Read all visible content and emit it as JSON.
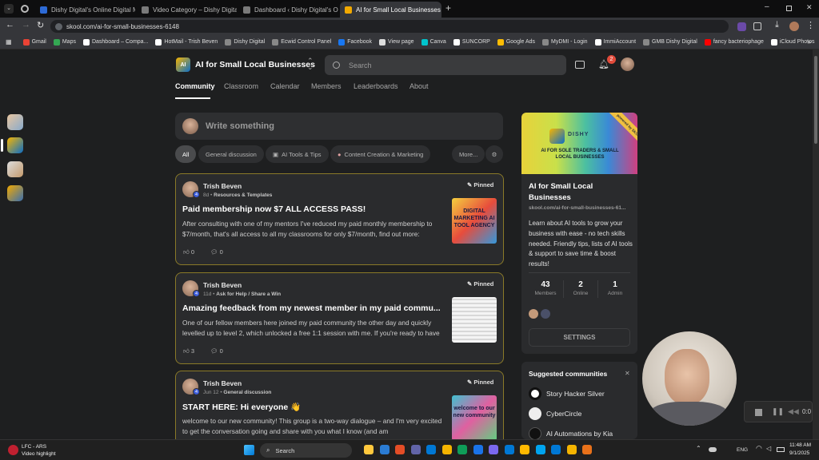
{
  "browser": {
    "tabs": [
      {
        "label": "Dishy Digital's Online Digital M",
        "color": "#2d6ad6"
      },
      {
        "label": "Video Category – Dishy Digital",
        "color": "#7a7a7a"
      },
      {
        "label": "Dashboard ‹ Dishy Digital's On",
        "color": "#7a7a7a"
      },
      {
        "label": "AI for Small Local Businesses",
        "color": "#f2a900"
      }
    ],
    "url": "skool.com/ai-for-small-businesses-6148",
    "bookmarks": [
      {
        "label": "Gmail",
        "color": "#ea4335"
      },
      {
        "label": "Maps",
        "color": "#34a853"
      },
      {
        "label": "Dashboard – Compa...",
        "color": "#ffffff"
      },
      {
        "label": "HotMail - Trish Beven",
        "color": "#ffffff"
      },
      {
        "label": "Dishy Digital",
        "color": "#888888"
      },
      {
        "label": "Ecwid Control Panel",
        "color": "#888888"
      },
      {
        "label": "Facebook",
        "color": "#1877f2"
      },
      {
        "label": "View page",
        "color": "#dddddd"
      },
      {
        "label": "Canva",
        "color": "#00c4cc"
      },
      {
        "label": "SUNCORP",
        "color": "#ffffff"
      },
      {
        "label": "Google Ads",
        "color": "#fbbc04"
      },
      {
        "label": "MyDMI - Login",
        "color": "#888888"
      },
      {
        "label": "ImmiAccount",
        "color": "#ffffff"
      },
      {
        "label": "GMB Dishy Digital",
        "color": "#888888"
      },
      {
        "label": "fancy bacteriophage",
        "color": "#ff0000"
      },
      {
        "label": "iCloud Photos",
        "color": "#ffffff"
      }
    ]
  },
  "header": {
    "logo_text": "AI",
    "group_name": "AI for Small Local Businesses",
    "search_placeholder": "Search",
    "notif_count": "2"
  },
  "nav": [
    "Community",
    "Classroom",
    "Calendar",
    "Members",
    "Leaderboards",
    "About"
  ],
  "composer": {
    "placeholder": "Write something"
  },
  "filters": [
    "All",
    "General discussion",
    "AI Tools & Tips",
    "Content Creation & Marketing",
    "More..."
  ],
  "posts": [
    {
      "author": "Trish Beven",
      "level": "4",
      "time": "8d",
      "category": "Resources & Templates",
      "pinned": "Pinned",
      "title": "Paid membership now $7 ALL ACCESS PASS!",
      "body": "After consulting with one of my mentors I've reduced my paid monthly membership to $7/month, that's all access to all my classrooms for only $7/month, find out more:",
      "likes": "0",
      "comments": "0",
      "thumb_text": "DIGITAL MARKETING AI TOOL AGENCY"
    },
    {
      "author": "Trish Beven",
      "level": "4",
      "time": "11d",
      "category": "Ask for Help / Share a Win",
      "pinned": "Pinned",
      "title": "Amazing feedback from my newest member in my paid commu...",
      "body": "One of our fellow members here joined my paid community the other day and quickly levelled up to level 2, which unlocked a free 1:1 session with me. If you're ready to have",
      "likes": "3",
      "comments": "0",
      "thumb_text": ""
    },
    {
      "author": "Trish Beven",
      "level": "4",
      "time": "Jun 12",
      "category": "General discussion",
      "pinned": "Pinned",
      "title": "START HERE: Hi everyone 👋",
      "body": "welcome to our new community! This group is a two-way dialogue – and I'm very excited to get the conversation going and share with you what I know (and am",
      "likes": "",
      "comments": "",
      "thumb_text": "welcome to our new community"
    }
  ],
  "group_card": {
    "banner_brand": "DISHY",
    "banner_text": "AI FOR SOLE TRADERS & SMALL LOCAL BUSINESSES",
    "ribbon": "powered by SKOOL",
    "name": "AI for Small Local Businesses",
    "url": "skool.com/ai-for-small-businesses-61...",
    "description": "Learn about AI tools to grow your business with ease - no tech skills needed. Friendly tips, lists of AI tools & support to save time & boost results!",
    "stats": [
      {
        "value": "43",
        "label": "Members"
      },
      {
        "value": "2",
        "label": "Online"
      },
      {
        "value": "1",
        "label": "Admin"
      }
    ],
    "settings_label": "SETTINGS"
  },
  "suggested": {
    "title": "Suggested communities",
    "items": [
      "Story Hacker Silver",
      "CyberCircle",
      "AI Automations by Kia"
    ]
  },
  "video_overlay": {
    "time": "0:0"
  },
  "taskbar": {
    "notif_title": "LFC - ARS",
    "notif_sub": "Video highlight",
    "search_label": "Search",
    "lang": "ENG",
    "time": "11:48 AM",
    "date": "9/1/2025"
  }
}
